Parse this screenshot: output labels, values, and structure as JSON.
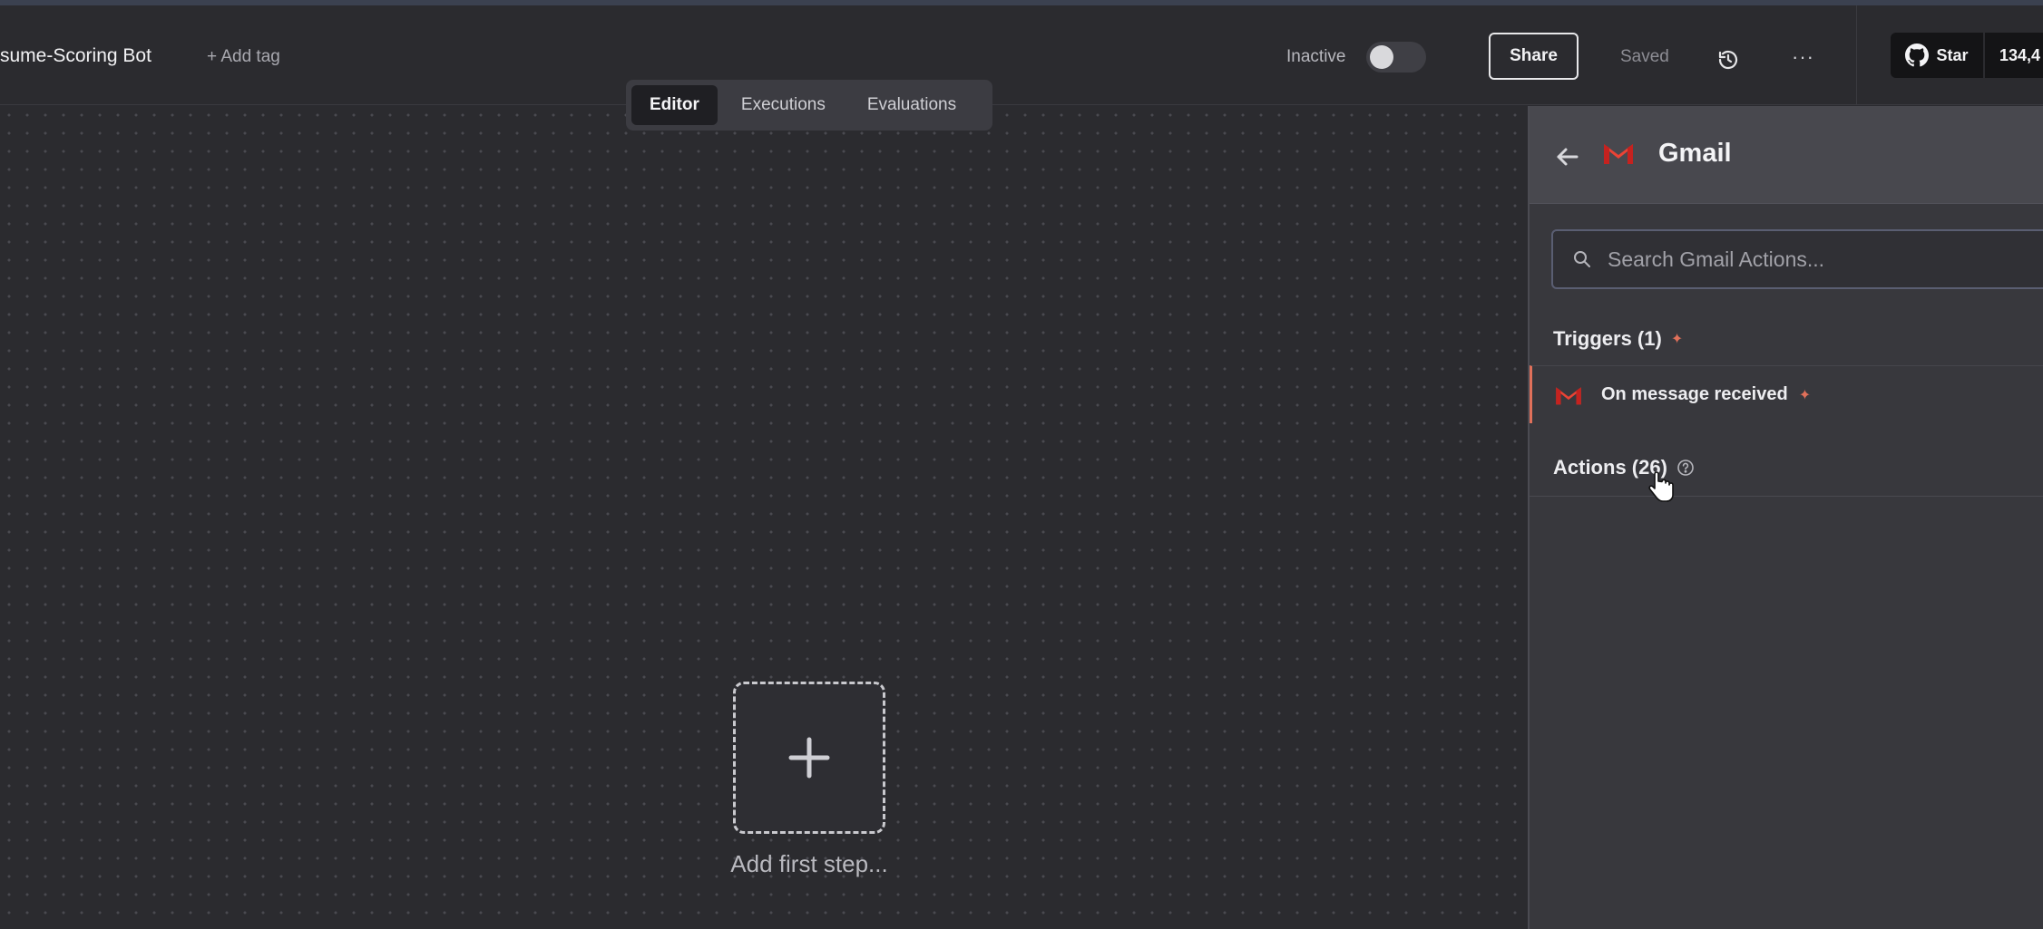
{
  "header": {
    "workflow_name": "sume-Scoring Bot",
    "add_tag": "+ Add tag",
    "active_label": "Inactive",
    "share_label": "Share",
    "save_status": "Saved",
    "more": "···",
    "github": {
      "star_label": "Star",
      "star_count": "134,4"
    }
  },
  "tabs": [
    {
      "label": "Editor",
      "active": true
    },
    {
      "label": "Executions",
      "active": false
    },
    {
      "label": "Evaluations",
      "active": false
    }
  ],
  "canvas": {
    "add_first_step": "Add first step..."
  },
  "panel": {
    "title": "Gmail",
    "search_placeholder": "Search Gmail Actions...",
    "triggers_title": "Triggers (1)",
    "trigger_items": [
      {
        "label": "On message received"
      }
    ],
    "actions_title": "Actions (26)"
  },
  "icons": {
    "back": "arrow-left-icon",
    "gmail": "gmail-logo-icon",
    "search": "search-icon",
    "history": "history-icon",
    "github": "github-icon",
    "help": "question-circle-icon",
    "plus": "plus-icon"
  },
  "colors": {
    "background": "#2b2b2f",
    "panel": "#38383d",
    "accent": "#e0705a",
    "gmail_red": "#ea4335"
  }
}
